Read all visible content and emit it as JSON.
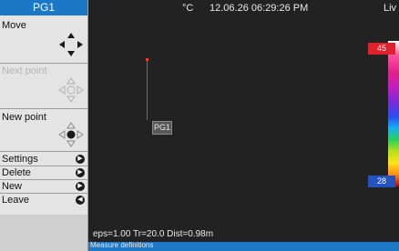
{
  "panel": {
    "title": "PG1",
    "move_label": "Move",
    "next_point_label": "Next point",
    "new_point_label": "New point",
    "menu": [
      {
        "label": "Settings",
        "icon": "circle-button-icon"
      },
      {
        "label": "Delete",
        "icon": "circle-button-icon"
      },
      {
        "label": "New",
        "icon": "circle-button-icon"
      },
      {
        "label": "Leave",
        "icon": "circle-button-icon"
      }
    ]
  },
  "header": {
    "unit": "°C",
    "datetime": "12.06.26 06:29:26 PM",
    "mode": "Liv"
  },
  "scale": {
    "max": "45",
    "min": "28"
  },
  "measurement": {
    "point_label": "PG1"
  },
  "status": {
    "params": "eps=1.00 Tr=20.0 Dist=0.98m",
    "bottom_text": "Measure definitions"
  },
  "colors": {
    "accent_blue": "#1b78c6",
    "scale_max_bg": "#e0202a",
    "scale_min_bg": "#2452c0"
  }
}
